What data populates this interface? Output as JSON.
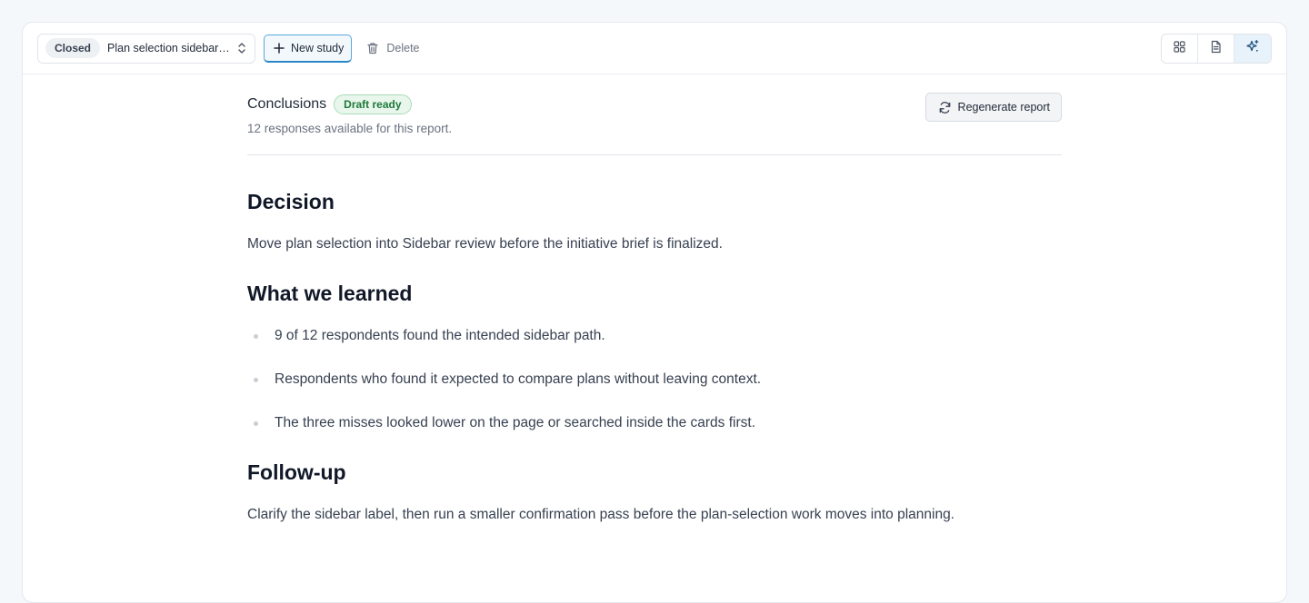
{
  "toolbar": {
    "status": "Closed",
    "study_name": "Plan selection sidebar…",
    "new_study_label": "New study",
    "delete_label": "Delete",
    "views": [
      {
        "name": "grid-view",
        "icon": "grid-icon"
      },
      {
        "name": "document-view",
        "icon": "document-icon"
      },
      {
        "name": "insights-view",
        "icon": "sparkle-icon",
        "active": true
      }
    ]
  },
  "report": {
    "title": "Conclusions",
    "badge": "Draft ready",
    "subtitle": "12 responses available for this report.",
    "regenerate_label": "Regenerate report"
  },
  "document": {
    "decision": {
      "heading": "Decision",
      "text": "Move plan selection into Sidebar review before the initiative brief is finalized."
    },
    "learned": {
      "heading": "What we learned",
      "items": [
        "9 of 12 respondents found the intended sidebar path.",
        "Respondents who found it expected to compare plans without leaving context.",
        "The three misses looked lower on the page or searched inside the cards first."
      ]
    },
    "followup": {
      "heading": "Follow-up",
      "text": "Clarify the sidebar label, then run a smaller confirmation pass before the plan-selection work moves into planning."
    }
  },
  "colors": {
    "accent": "#2b86c7",
    "badge_green": "#1f7a3a",
    "page_bg": "#f5f8fb"
  }
}
